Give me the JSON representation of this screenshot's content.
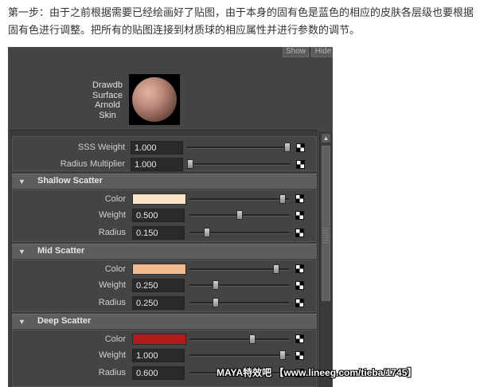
{
  "intro_text": "第一步：由于之前根据需要已经绘画好了贴图，由于本身的固有色是蓝色的相应的皮肤各层级也要根据固有色进行调整。把所有的贴图连接到材质球的相应属性并进行参数的调节。",
  "top_buttons": {
    "show": "Show",
    "hide": "Hide"
  },
  "swatch": {
    "line1": "Drawdb",
    "line2": "Surface",
    "line3": "Arnold",
    "line4": "Skin"
  },
  "global": {
    "sss_weight": {
      "label": "SSS Weight",
      "value": "1.000",
      "slider": 1.0
    },
    "radius_multiplier": {
      "label": "Radius Multiplier",
      "value": "1.000",
      "slider": 0.0
    }
  },
  "sections": {
    "shallow": {
      "title": "Shallow Scatter",
      "color": {
        "label": "Color",
        "hex": "#fde4c6",
        "slider": 0.97
      },
      "weight": {
        "label": "Weight",
        "value": "0.500",
        "slider": 0.5
      },
      "radius": {
        "label": "Radius",
        "value": "0.150",
        "slider": 0.15
      }
    },
    "mid": {
      "title": "Mid Scatter",
      "color": {
        "label": "Color",
        "hex": "#f0b98e",
        "slider": 0.9
      },
      "weight": {
        "label": "Weight",
        "value": "0.250",
        "slider": 0.25
      },
      "radius": {
        "label": "Radius",
        "value": "0.250",
        "slider": 0.25
      }
    },
    "deep": {
      "title": "Deep Scatter",
      "color": {
        "label": "Color",
        "hex": "#b51a1a",
        "slider": 0.64
      },
      "weight": {
        "label": "Weight",
        "value": "1.000",
        "slider": 0.97
      },
      "radius": {
        "label": "Radius",
        "value": "0.600",
        "slider": 0.6
      }
    }
  },
  "watermark": "MAYA特效吧 【www.lineeg.com/tieba/1745】"
}
